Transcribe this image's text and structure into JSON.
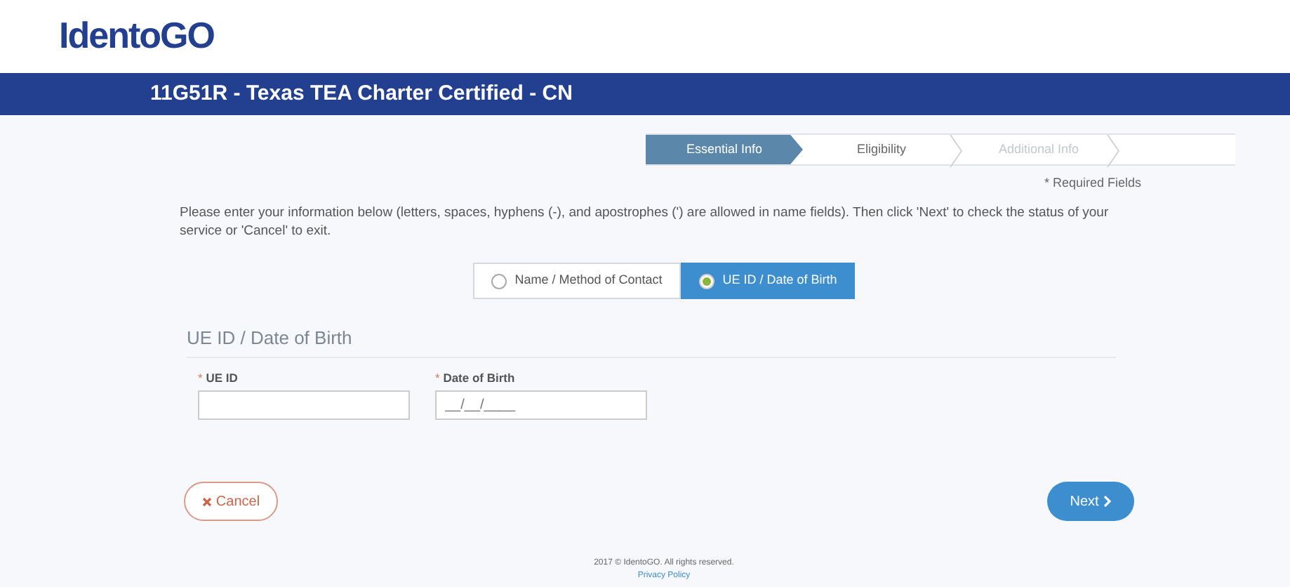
{
  "logo": "IdentoGO",
  "banner": {
    "title": "11G51R - Texas TEA Charter Certified - CN"
  },
  "steps": [
    {
      "label": "Essential Info",
      "selected": true,
      "disabled": false
    },
    {
      "label": "Eligibility",
      "selected": false,
      "disabled": false
    },
    {
      "label": "Additional Info",
      "selected": false,
      "disabled": true
    }
  ],
  "required_note": "* Required Fields",
  "instructions": "Please enter your information below (letters, spaces, hyphens (-), and apostrophes (') are allowed in name fields). Then click 'Next' to check the status of your service or 'Cancel' to exit.",
  "lookup_options": [
    {
      "label": "Name / Method of Contact",
      "selected": false
    },
    {
      "label": "UE ID / Date of Birth",
      "selected": true
    }
  ],
  "section": {
    "title": "UE ID / Date of Birth",
    "fields": [
      {
        "label": "UE ID",
        "required_mark": "*"
      },
      {
        "label": "Date of Birth",
        "required_mark": "*",
        "placeholder": "__/__/____"
      }
    ]
  },
  "buttons": {
    "cancel": "Cancel",
    "next": "Next"
  },
  "footer": {
    "copyright": "2017 © IdentoGO. All rights reserved.",
    "link": "Privacy Policy"
  }
}
